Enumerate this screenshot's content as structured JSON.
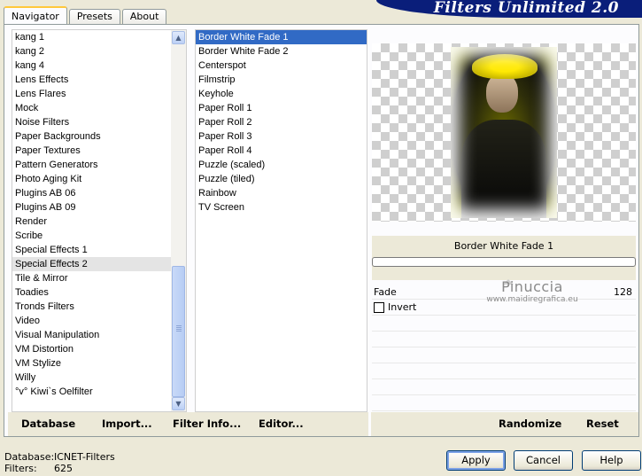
{
  "tabs": [
    "Navigator",
    "Presets",
    "About"
  ],
  "brand": "Filters Unlimited 2.0",
  "categories": [
    "kang 1",
    "kang 2",
    "kang 4",
    "Lens Effects",
    "Lens Flares",
    "Mock",
    "Noise Filters",
    "Paper Backgrounds",
    "Paper Textures",
    "Pattern Generators",
    "Photo Aging Kit",
    "Plugins AB 06",
    "Plugins AB 09",
    "Render",
    "Scribe",
    "Special Effects 1",
    "Special Effects 2",
    "Tile & Mirror",
    "Toadies",
    "Tronds Filters",
    "Video",
    "Visual Manipulation",
    "VM Distortion",
    "VM Stylize",
    "Willy",
    "°v° Kiwi`s Oelfilter"
  ],
  "selected_category": "Special Effects 2",
  "filters": [
    "Border White Fade 1",
    "Border White Fade 2",
    "Centerspot",
    "Filmstrip",
    "Keyhole",
    "Paper Roll 1",
    "Paper Roll 2",
    "Paper Roll 3",
    "Paper Roll 4",
    "Puzzle (scaled)",
    "Puzzle (tiled)",
    "Rainbow",
    "TV Screen"
  ],
  "selected_filter": "Border White Fade 1",
  "left_actions": {
    "database": "Database",
    "import": "Import...",
    "filter_info": "Filter Info...",
    "editor": "Editor..."
  },
  "right_actions": {
    "randomize": "Randomize",
    "reset": "Reset"
  },
  "preview": {
    "filter_title": "Border White Fade 1"
  },
  "params": {
    "fade_label": "Fade",
    "fade_value": "128",
    "invert_label": "Invert",
    "invert_checked": false
  },
  "watermark": {
    "line1": "Pinuccia",
    "line2": "www.maidiregrafica.eu"
  },
  "footer": {
    "database_label": "Database:",
    "database_value": "ICNET-Filters",
    "filters_label": "Filters:",
    "filters_value": "625"
  },
  "dialog_buttons": {
    "apply": "Apply",
    "cancel": "Cancel",
    "help": "Help"
  },
  "colors": {
    "selection_blue": "#316ac5",
    "brand_bar": "#0a1e7a",
    "tab_highlight": "#ffc83c"
  }
}
